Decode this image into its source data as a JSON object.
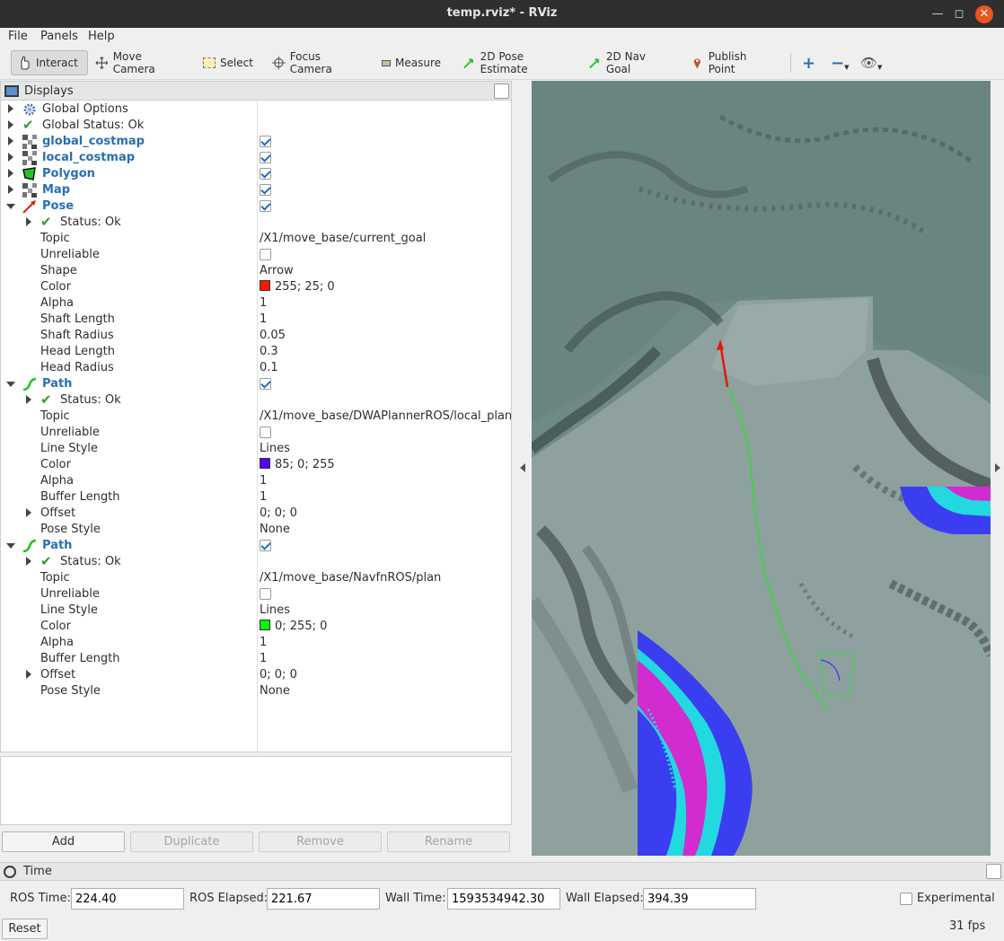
{
  "window": {
    "title": "temp.rviz* - RViz"
  },
  "menu": [
    "File",
    "Panels",
    "Help"
  ],
  "toolbar": {
    "interact": "Interact",
    "move_camera": "Move Camera",
    "select": "Select",
    "focus_camera": "Focus Camera",
    "measure": "Measure",
    "pose_estimate": "2D Pose Estimate",
    "nav_goal": "2D Nav Goal",
    "publish_point": "Publish Point"
  },
  "displays": {
    "title": "Displays",
    "rows": [
      {
        "name": "Global Options"
      },
      {
        "name": "Global Status: Ok"
      },
      {
        "name": "global_costmap",
        "checked": true
      },
      {
        "name": "local_costmap",
        "checked": true
      },
      {
        "name": "Polygon",
        "checked": true
      },
      {
        "name": "Map",
        "checked": true
      },
      {
        "name": "Pose",
        "checked": true
      },
      {
        "name": "Status: Ok"
      },
      {
        "name": "Topic",
        "value": "/X1/move_base/current_goal"
      },
      {
        "name": "Unreliable"
      },
      {
        "name": "Shape",
        "value": "Arrow"
      },
      {
        "name": "Color",
        "value": "255; 25; 0",
        "color": "#ff1900"
      },
      {
        "name": "Alpha",
        "value": "1"
      },
      {
        "name": "Shaft Length",
        "value": "1"
      },
      {
        "name": "Shaft Radius",
        "value": "0.05"
      },
      {
        "name": "Head Length",
        "value": "0.3"
      },
      {
        "name": "Head Radius",
        "value": "0.1"
      },
      {
        "name": "Path",
        "checked": true
      },
      {
        "name": "Status: Ok"
      },
      {
        "name": "Topic",
        "value": "/X1/move_base/DWAPlannerROS/local_plan"
      },
      {
        "name": "Unreliable"
      },
      {
        "name": "Line Style",
        "value": "Lines"
      },
      {
        "name": "Color",
        "value": "85; 0; 255",
        "color": "#5500ff"
      },
      {
        "name": "Alpha",
        "value": "1"
      },
      {
        "name": "Buffer Length",
        "value": "1"
      },
      {
        "name": "Offset",
        "value": "0; 0; 0"
      },
      {
        "name": "Pose Style",
        "value": "None"
      },
      {
        "name": "Path",
        "checked": true
      },
      {
        "name": "Status: Ok"
      },
      {
        "name": "Topic",
        "value": "/X1/move_base/NavfnROS/plan"
      },
      {
        "name": "Unreliable"
      },
      {
        "name": "Line Style",
        "value": "Lines"
      },
      {
        "name": "Color",
        "value": "0; 255; 0",
        "color": "#00ff00"
      },
      {
        "name": "Alpha",
        "value": "1"
      },
      {
        "name": "Buffer Length",
        "value": "1"
      },
      {
        "name": "Offset",
        "value": "0; 0; 0"
      },
      {
        "name": "Pose Style",
        "value": "None"
      }
    ]
  },
  "buttons": {
    "add": "Add",
    "duplicate": "Duplicate",
    "remove": "Remove",
    "rename": "Rename"
  },
  "time": {
    "title": "Time",
    "ros_time_label": "ROS Time:",
    "ros_time": "224.40",
    "ros_elapsed_label": "ROS Elapsed:",
    "ros_elapsed": "221.67",
    "wall_time_label": "Wall Time:",
    "wall_time": "1593534942.30",
    "wall_elapsed_label": "Wall Elapsed:",
    "wall_elapsed": "394.39",
    "experimental": "Experimental",
    "reset": "Reset",
    "fps": "31 fps"
  }
}
